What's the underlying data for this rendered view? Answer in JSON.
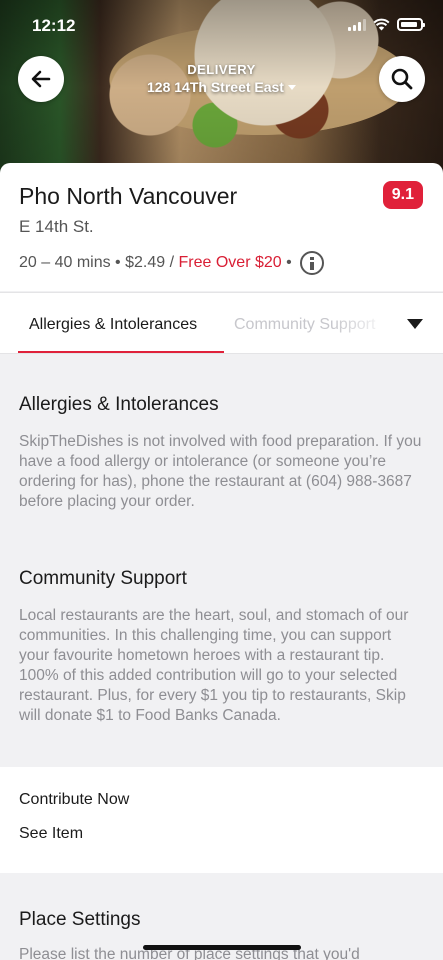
{
  "status_bar": {
    "time": "12:12"
  },
  "header": {
    "delivery_label": "DELIVERY",
    "address": "128 14Th Street East"
  },
  "restaurant": {
    "name": "Pho North Vancouver",
    "rating": "9.1",
    "street": "E 14th St.",
    "eta": "20 – 40 mins",
    "fee": "$2.49",
    "free_over": "Free Over $20"
  },
  "tabs": {
    "items": [
      {
        "label": "Allergies & Intolerances"
      },
      {
        "label": "Community Support"
      }
    ]
  },
  "allergies": {
    "heading": "Allergies & Intolerances",
    "body": "SkipTheDishes is not involved with food preparation. If you have a food allergy or intolerance (or someone you’re ordering for has), phone the restaurant at (604) 988-3687 before placing your order."
  },
  "community": {
    "heading": "Community Support",
    "body": "Local restaurants are the heart, soul, and stomach of our communities. In this challenging time, you can support your favourite hometown heroes with a restaurant tip. 100% of this added contribution will go to your selected restaurant. Plus, for every $1 you tip to restaurants, Skip will donate $1 to Food Banks Canada.",
    "contribute_label": "Contribute Now",
    "see_item_label": "See Item"
  },
  "place_settings": {
    "heading": "Place Settings",
    "body": "Please list the number of place settings that you'd"
  },
  "colors": {
    "accent": "#e0213a",
    "free_text": "#d91f35"
  }
}
